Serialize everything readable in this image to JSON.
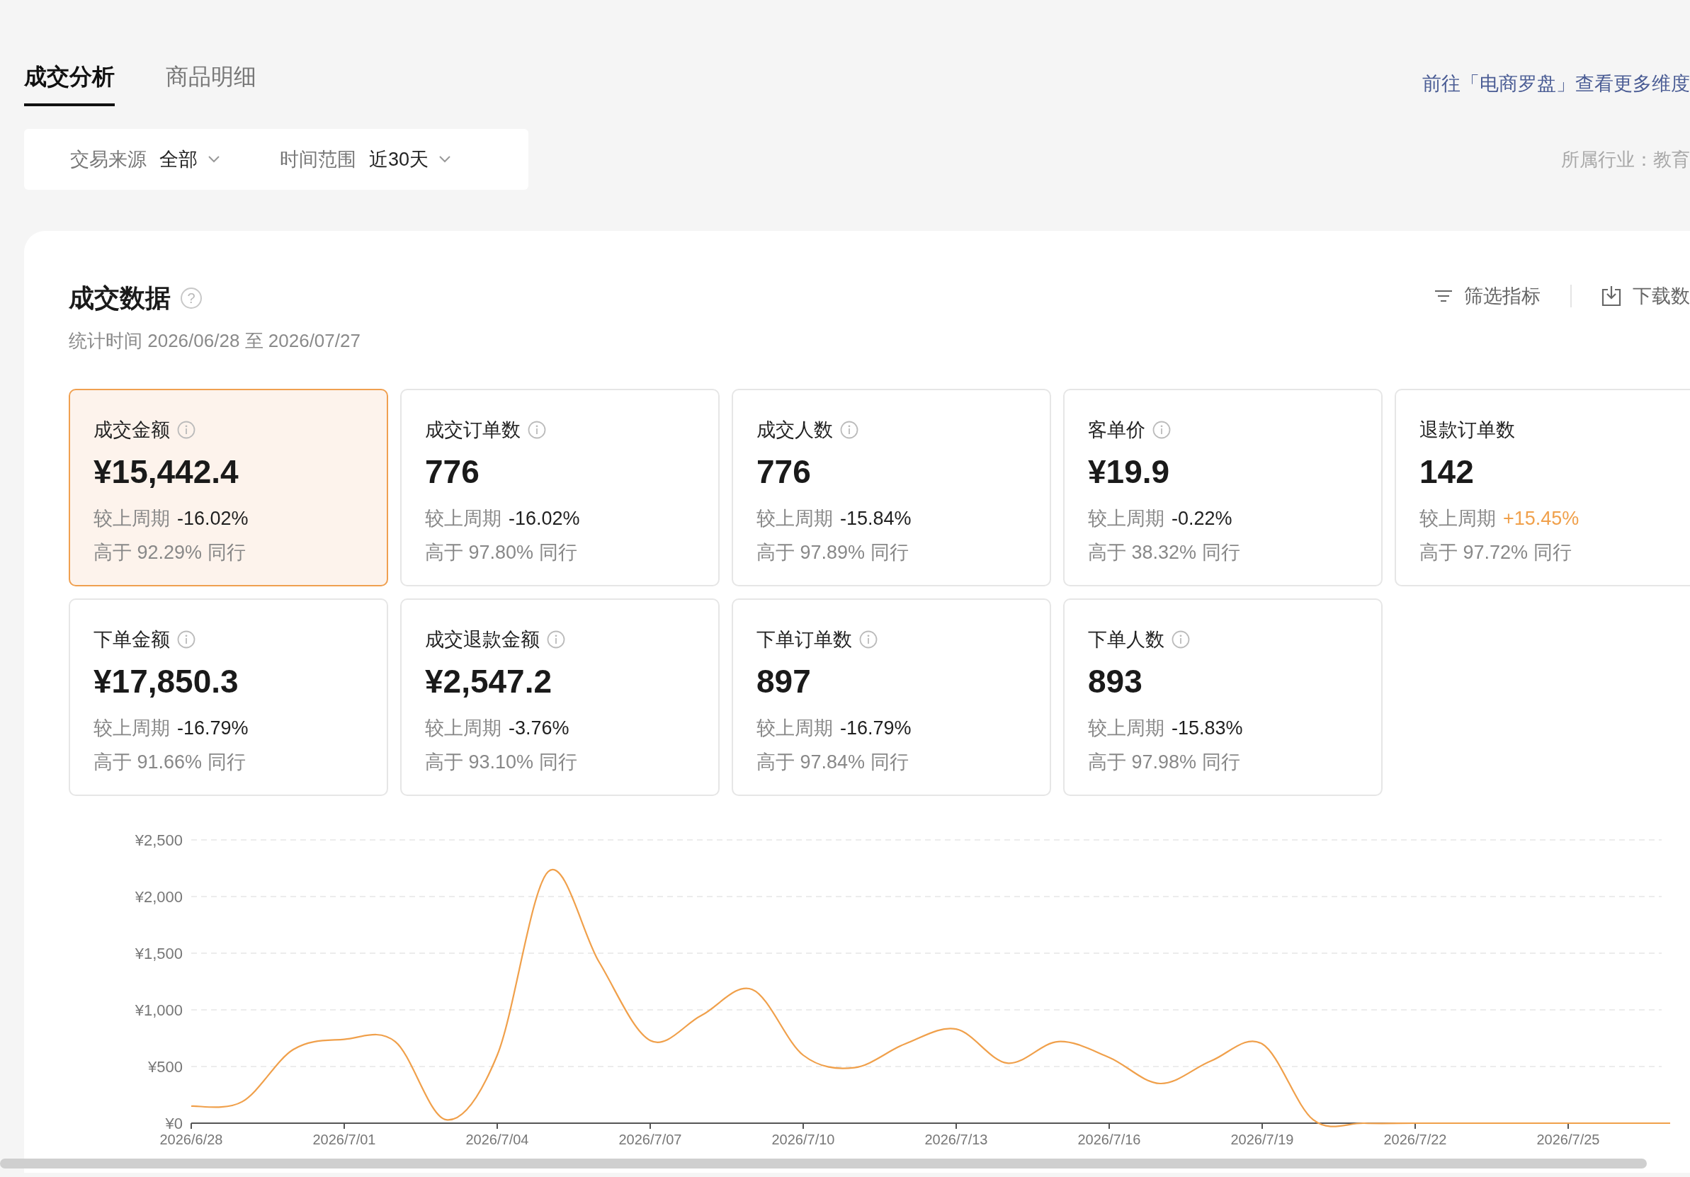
{
  "tabs": [
    {
      "label": "成交分析",
      "selected": true
    },
    {
      "label": "商品明细",
      "selected": false
    }
  ],
  "compass_link": "前往「电商罗盘」查看更多维度",
  "filters": [
    {
      "label": "交易来源",
      "value": "全部"
    },
    {
      "label": "时间范围",
      "value": "近30天"
    }
  ],
  "industry": "所属行业：教育",
  "panel": {
    "title": "成交数据",
    "help_glyph": "?",
    "period": "统计时间 2026/06/28 至 2026/07/27",
    "actions": [
      "筛选指标",
      "下载数"
    ]
  },
  "metrics": [
    {
      "label": "成交金额",
      "info": true,
      "value": "¥15,442.4",
      "compare_label": "较上周期",
      "change": "-16.02%",
      "rising": false,
      "peer": "高于 92.29% 同行",
      "selected": true
    },
    {
      "label": "成交订单数",
      "info": true,
      "value": "776",
      "compare_label": "较上周期",
      "change": "-16.02%",
      "rising": false,
      "peer": "高于 97.80% 同行",
      "selected": false
    },
    {
      "label": "成交人数",
      "info": true,
      "value": "776",
      "compare_label": "较上周期",
      "change": "-15.84%",
      "rising": false,
      "peer": "高于 97.89% 同行",
      "selected": false
    },
    {
      "label": "客单价",
      "info": true,
      "value": "¥19.9",
      "compare_label": "较上周期",
      "change": "-0.22%",
      "rising": false,
      "peer": "高于 38.32% 同行",
      "selected": false
    },
    {
      "label": "退款订单数",
      "info": false,
      "value": "142",
      "compare_label": "较上周期",
      "change": "+15.45%",
      "rising": true,
      "peer": "高于 97.72% 同行",
      "selected": false
    },
    {
      "label": "下单金额",
      "info": true,
      "value": "¥17,850.3",
      "compare_label": "较上周期",
      "change": "-16.79%",
      "rising": false,
      "peer": "高于 91.66% 同行",
      "selected": false
    },
    {
      "label": "成交退款金额",
      "info": true,
      "value": "¥2,547.2",
      "compare_label": "较上周期",
      "change": "-3.76%",
      "rising": false,
      "peer": "高于 93.10% 同行",
      "selected": false
    },
    {
      "label": "下单订单数",
      "info": true,
      "value": "897",
      "compare_label": "较上周期",
      "change": "-16.79%",
      "rising": false,
      "peer": "高于 97.84% 同行",
      "selected": false
    },
    {
      "label": "下单人数",
      "info": true,
      "value": "893",
      "compare_label": "较上周期",
      "change": "-15.83%",
      "rising": false,
      "peer": "高于 97.98% 同行",
      "selected": false
    }
  ],
  "chart_data": {
    "type": "line",
    "grid": true,
    "categories": [
      "2026/6/28",
      null,
      null,
      "2026/7/01",
      null,
      null,
      "2026/7/04",
      null,
      null,
      "2026/7/07",
      null,
      null,
      "2026/7/10",
      null,
      null,
      "2026/7/13",
      null,
      null,
      "2026/7/16",
      null,
      null,
      "2026/7/19",
      null,
      null,
      "2026/7/22",
      null,
      null,
      "2026/7/25",
      null,
      null
    ],
    "series": [
      {
        "color": "#f0a04b",
        "values": [
          150,
          190,
          650,
          740,
          720,
          30,
          600,
          2220,
          1420,
          730,
          950,
          1180,
          600,
          490,
          700,
          830,
          530,
          720,
          580,
          350,
          550,
          700,
          30,
          0,
          0,
          0,
          0,
          0,
          0,
          0
        ]
      }
    ],
    "ylim": [
      0,
      2500
    ],
    "yticks": [
      {
        "value": 0,
        "label": "¥0"
      },
      {
        "value": 500,
        "label": "¥500"
      },
      {
        "value": 1000,
        "label": "¥1,000"
      },
      {
        "value": 1500,
        "label": "¥1,500"
      },
      {
        "value": 2000,
        "label": "¥2,000"
      },
      {
        "value": 2500,
        "label": "¥2,500"
      }
    ]
  }
}
